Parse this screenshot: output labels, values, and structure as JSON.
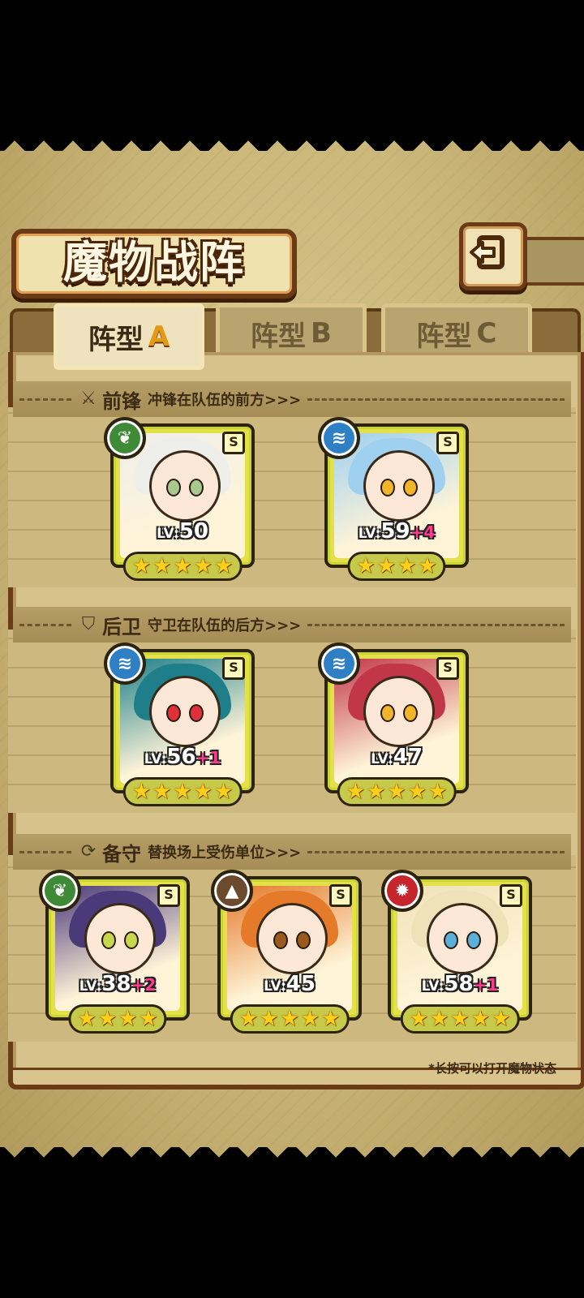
{
  "header": {
    "title": "魔物战阵",
    "back_icon": "back-arrow-icon"
  },
  "tabs": [
    {
      "label": "阵型",
      "letter": "A",
      "active": true
    },
    {
      "label": "阵型",
      "letter": "B",
      "active": false
    },
    {
      "label": "阵型",
      "letter": "C",
      "active": false
    }
  ],
  "sections": {
    "front": {
      "title": "前锋",
      "desc": "冲锋在队伍的前方>>>",
      "icon": "sword-icon"
    },
    "back": {
      "title": "后卫",
      "desc": "守卫在队伍的后方>>>",
      "icon": "shield-icon"
    },
    "reserve": {
      "title": "备守",
      "desc": "替换场上受伤单位>>>",
      "icon": "swap-icon"
    }
  },
  "cards": [
    {
      "level": "50",
      "plus": "",
      "stars": 5,
      "rarity": "S",
      "element": "green",
      "element_icon": "leaf-icon",
      "hair": "#eeeeea",
      "eye": "#a8c98d"
    },
    {
      "level": "59",
      "plus": "+4",
      "stars": 4,
      "rarity": "S",
      "element": "blue",
      "element_icon": "water-icon",
      "hair": "#9fd0ef",
      "eye": "#f2b528"
    },
    {
      "level": "56",
      "plus": "+1",
      "stars": 5,
      "rarity": "S",
      "element": "blue",
      "element_icon": "water-icon",
      "hair": "#1e7f8a",
      "eye": "#e0303a"
    },
    {
      "level": "47",
      "plus": "",
      "stars": 5,
      "rarity": "S",
      "element": "blue",
      "element_icon": "water-icon",
      "hair": "#c2364a",
      "eye": "#f2b528"
    },
    {
      "level": "38",
      "plus": "+2",
      "stars": 4,
      "rarity": "S",
      "element": "green",
      "element_icon": "leaf-icon",
      "hair": "#4b3a7a",
      "eye": "#c8d84a"
    },
    {
      "level": "45",
      "plus": "",
      "stars": 5,
      "rarity": "S",
      "element": "brown",
      "element_icon": "earth-icon",
      "hair": "#e47a2a",
      "eye": "#9a5a1e"
    },
    {
      "level": "58",
      "plus": "+1",
      "stars": 5,
      "rarity": "S",
      "element": "red",
      "element_icon": "fire-icon",
      "hair": "#f0e2b8",
      "eye": "#5ab0d8"
    }
  ],
  "labels": {
    "lv_prefix": "LV:"
  },
  "hint": "*长按可以打开魔物状态"
}
